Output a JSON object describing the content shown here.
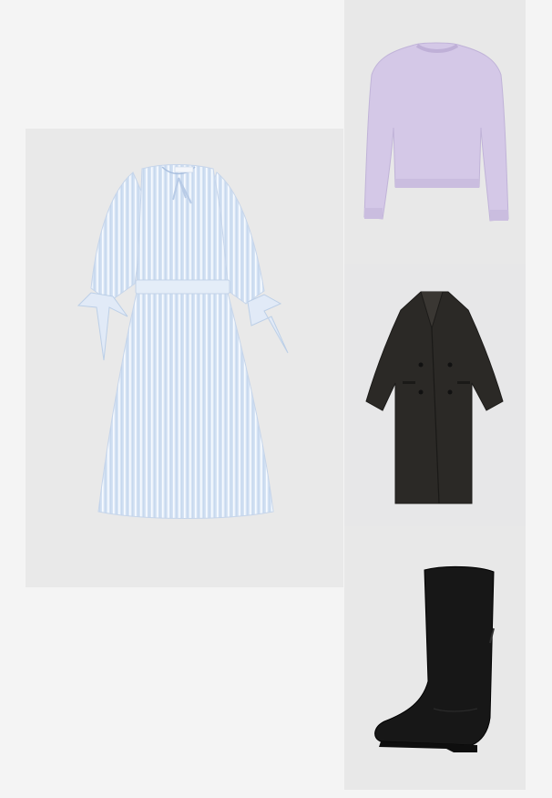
{
  "collage": {
    "items": [
      {
        "name": "striped-shirt-dress",
        "icon": "dress-photo"
      },
      {
        "name": "lavender-knit-sweater",
        "icon": "sweater-photo"
      },
      {
        "name": "long-double-breasted-coat",
        "icon": "coat-photo"
      },
      {
        "name": "black-knee-high-boot",
        "icon": "boot-photo"
      }
    ],
    "colors": {
      "background": "#f4f4f4",
      "tile": "#e8e8e8",
      "dress": "#dbe6f5",
      "dress_stripe": "#ffffff",
      "sweater": "#d3c7e6",
      "coat": "#2a2826",
      "boot": "#161616"
    }
  }
}
